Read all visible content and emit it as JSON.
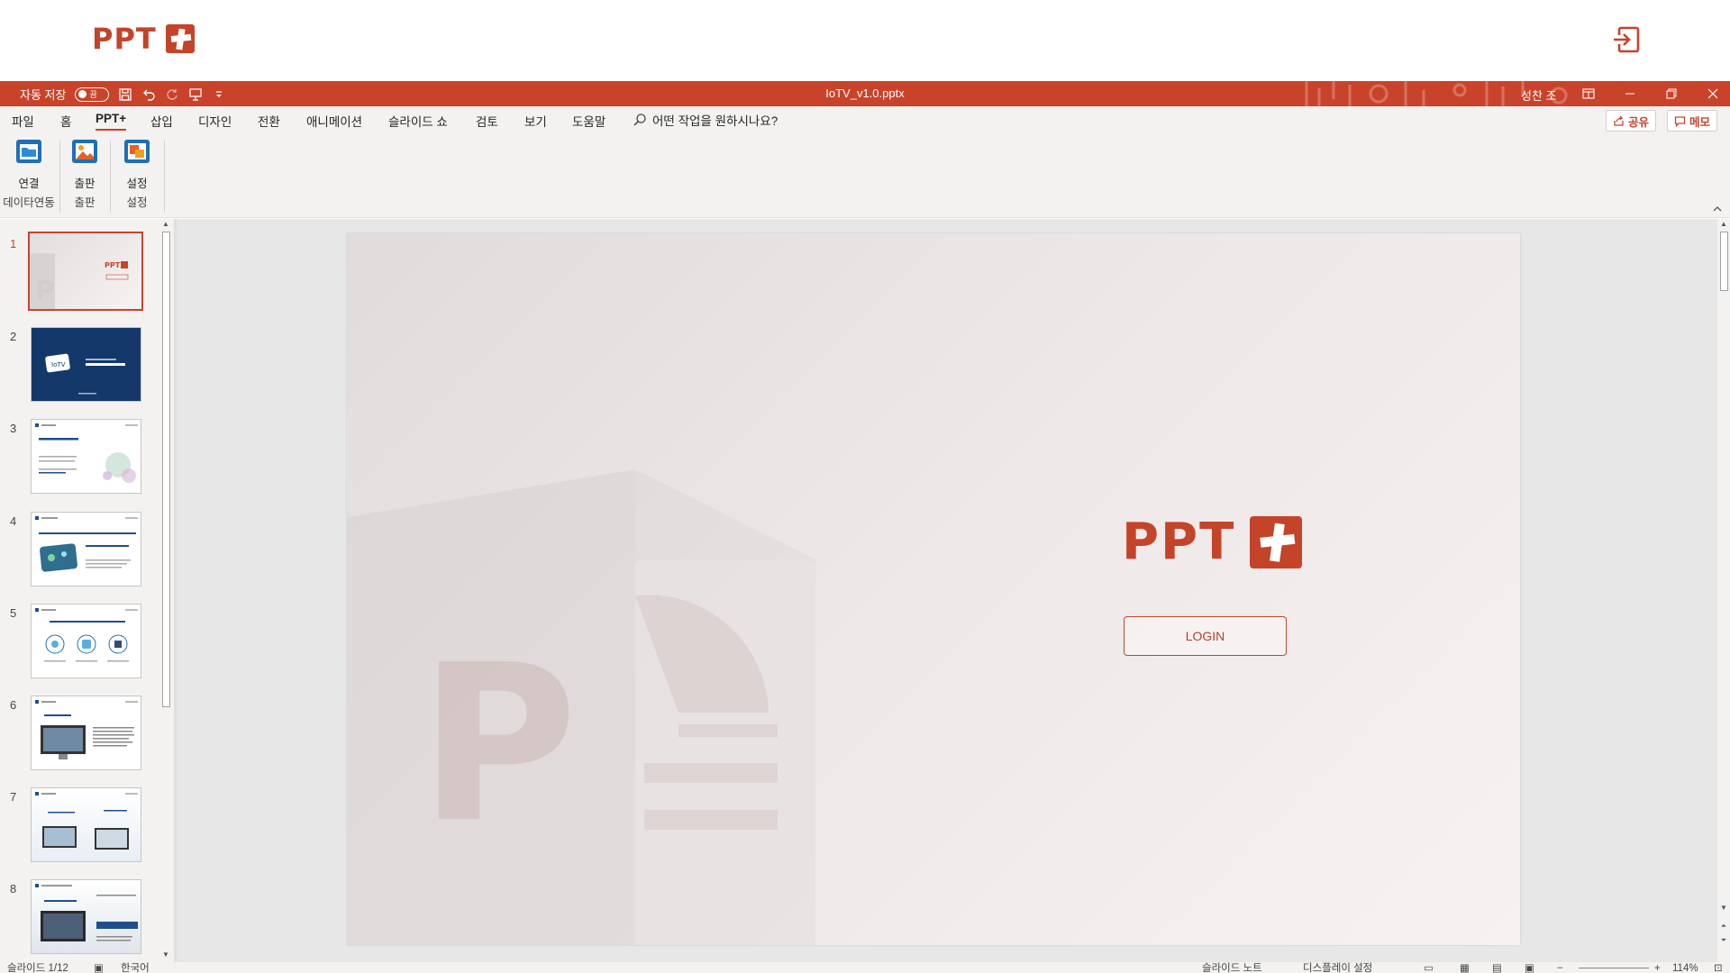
{
  "appbar": {
    "brand_text": "PPT",
    "exit_icon": "sign-out-icon"
  },
  "titlebar": {
    "autosave_label": "자동 저장",
    "autosave_state": "끔",
    "document_title": "IoTV_v1.0.pptx",
    "user_name": "성찬 조",
    "quick_access": [
      "save-icon",
      "undo-icon",
      "redo-icon",
      "present-icon",
      "customize-icon"
    ],
    "window_buttons": [
      "ribbon-display-icon",
      "minimize-icon",
      "restore-icon",
      "close-icon"
    ],
    "accent_color": "#c9432b"
  },
  "tabs": {
    "items": [
      "파일",
      "홈",
      "PPT+",
      "삽입",
      "디자인",
      "전환",
      "애니메이션",
      "슬라이드 쇼",
      "검토",
      "보기",
      "도움말"
    ],
    "active": "PPT+",
    "tell_me": "어떤 작업을 원하시나요?",
    "share_label": "공유",
    "memo_label": "메모"
  },
  "ribbon": {
    "groups": [
      {
        "button": "연결",
        "group": "데이타연동"
      },
      {
        "button": "출판",
        "group": "출판"
      },
      {
        "button": "설정",
        "group": "설정"
      }
    ]
  },
  "thumbnails": {
    "selected": 1,
    "slides": [
      {
        "num": "1",
        "brand": "PPT"
      },
      {
        "num": "2",
        "brand": "IoTV"
      },
      {
        "num": "3"
      },
      {
        "num": "4"
      },
      {
        "num": "5"
      },
      {
        "num": "6"
      },
      {
        "num": "7"
      },
      {
        "num": "8"
      }
    ]
  },
  "slide": {
    "brand_text": "PPT",
    "login_label": "LOGIN",
    "brand_color": "#c4442a"
  },
  "statusbar": {
    "slide_info": "슬라이드 1/12",
    "language": "한국어",
    "notes": "슬라이드 노트",
    "display_settings": "디스플레이 설정",
    "zoom": "114%"
  }
}
